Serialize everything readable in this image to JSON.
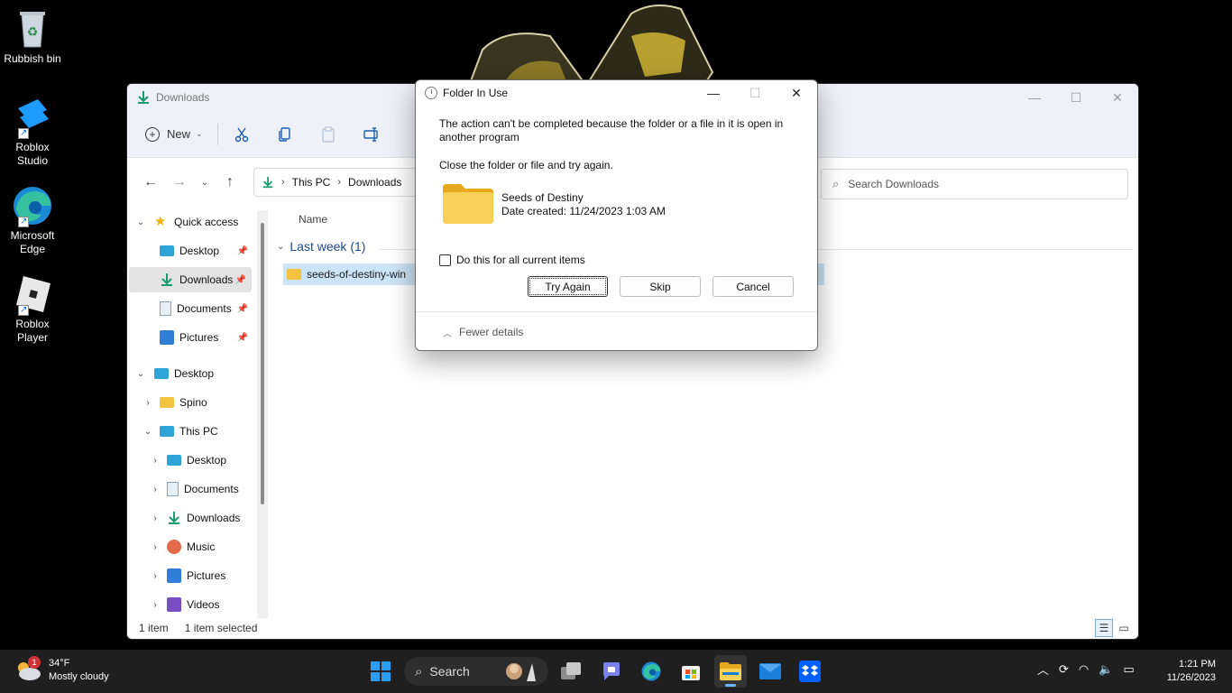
{
  "desktop": {
    "icons": [
      {
        "label": "Rubbish bin"
      },
      {
        "label": "Roblox Studio"
      },
      {
        "label": "Microsoft Edge"
      },
      {
        "label": "Roblox Player"
      }
    ]
  },
  "explorer": {
    "title": "Downloads",
    "toolbar": {
      "new_label": "New"
    },
    "address": {
      "segments": [
        "This PC",
        "Downloads"
      ]
    },
    "search_placeholder": "Search Downloads",
    "nav": {
      "quick_access": "Quick access",
      "qa_items": [
        "Desktop",
        "Downloads",
        "Documents",
        "Pictures"
      ],
      "desktop": "Desktop",
      "spino": "Spino",
      "this_pc": "This PC",
      "pc_items": [
        "Desktop",
        "Documents",
        "Downloads",
        "Music",
        "Pictures",
        "Videos"
      ]
    },
    "columns": {
      "name": "Name"
    },
    "group": {
      "label": "Last week (1)"
    },
    "files": [
      {
        "name": "seeds-of-destiny-win"
      }
    ],
    "status": {
      "count": "1 item",
      "selected": "1 item selected"
    }
  },
  "dialog": {
    "title": "Folder In Use",
    "message": "The action can't be completed because the folder or a file in it is open in another program",
    "instruction": "Close the folder or file and try again.",
    "item_name": "Seeds of Destiny",
    "item_date": "Date created: 11/24/2023 1:03 AM",
    "checkbox_label": "Do this for all current items",
    "checkbox_checked": false,
    "buttons": {
      "try_again": "Try Again",
      "skip": "Skip",
      "cancel": "Cancel"
    },
    "details_toggle": "Fewer details"
  },
  "taskbar": {
    "weather": {
      "temp": "34°F",
      "condition": "Mostly cloudy",
      "badge": "1"
    },
    "search_label": "Search",
    "apps": [
      "task-view",
      "teams-chat",
      "edge",
      "microsoft-store",
      "file-explorer",
      "mail",
      "dropbox"
    ],
    "clock": {
      "time": "1:21 PM",
      "date": "11/26/2023"
    }
  },
  "colors": {
    "accent": "#0067c0",
    "selection": "#cce4f7",
    "taskbar": "#1f1f1f",
    "folder": "#f3c23e"
  }
}
